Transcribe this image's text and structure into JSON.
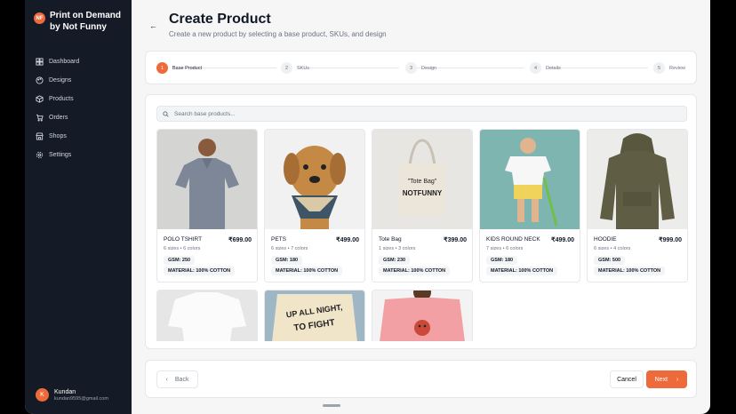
{
  "brand": {
    "logo": "NF",
    "name": "Print on Demand by Not Funny"
  },
  "nav": [
    {
      "label": "Dashboard",
      "icon": "grid-icon"
    },
    {
      "label": "Designs",
      "icon": "palette-icon"
    },
    {
      "label": "Products",
      "icon": "box-icon"
    },
    {
      "label": "Orders",
      "icon": "cart-icon"
    },
    {
      "label": "Shops",
      "icon": "store-icon"
    },
    {
      "label": "Settings",
      "icon": "gear-icon"
    }
  ],
  "user": {
    "initial": "K",
    "name": "Kundan",
    "email": "kundan9595@gmail.com"
  },
  "page": {
    "title": "Create Product",
    "subtitle": "Create a new product by selecting a base product, SKUs, and design"
  },
  "steps": [
    {
      "num": "1",
      "label": "Base Product",
      "active": true
    },
    {
      "num": "2",
      "label": "SKUs"
    },
    {
      "num": "3",
      "label": "Design"
    },
    {
      "num": "4",
      "label": "Details"
    },
    {
      "num": "5",
      "label": "Review"
    }
  ],
  "search": {
    "placeholder": "Search base products..."
  },
  "products": [
    {
      "name": "POLO TSHIRT",
      "price": "₹699.00",
      "meta": "6 sizes • 6 colors",
      "gsm": "GSM: 250",
      "material": "MATERIAL: 100% COTTON"
    },
    {
      "name": "PETS",
      "price": "₹499.00",
      "meta": "6 sizes • 7 colors",
      "gsm": "GSM: 180",
      "material": "MATERIAL: 100% COTTON"
    },
    {
      "name": "Tote Bag",
      "price": "₹399.00",
      "meta": "1 sizes • 3 colors",
      "gsm": "GSM: 230",
      "material": "MATERIAL: 100% COTTON",
      "image_text": "\"Tote Bag\" NOTFUNNY"
    },
    {
      "name": "KIDS ROUND NECK",
      "price": "₹499.00",
      "meta": "7 sizes • 6 colors",
      "gsm": "GSM: 180",
      "material": "MATERIAL: 100% COTTON"
    },
    {
      "name": "HOODIE",
      "price": "₹999.00",
      "meta": "6 sizes • 4 colors",
      "gsm": "GSM: 500",
      "material": "MATERIAL: 100% COTTON"
    }
  ],
  "partial_products": [
    {
      "image": "white-tshirt-image"
    },
    {
      "image": "printed-tshirt-image",
      "image_text": "UP ALL NIGHT, TO FIGHT"
    },
    {
      "image": "pink-tshirt-image"
    }
  ],
  "footer": {
    "back": "Back",
    "cancel": "Cancel",
    "next": "Next"
  },
  "colors": {
    "accent": "#ef6a3a",
    "sidebar": "#141a26"
  }
}
